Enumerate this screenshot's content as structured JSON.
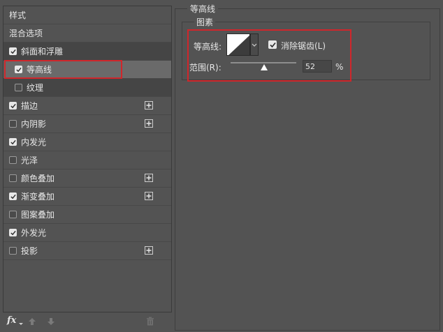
{
  "left": {
    "items": [
      {
        "label": "样式",
        "type": "header"
      },
      {
        "label": "混合选项",
        "type": "header"
      },
      {
        "label": "斜面和浮雕",
        "checked": true,
        "add": false,
        "state": "active"
      },
      {
        "label": "等高线",
        "checked": true,
        "add": false,
        "state": "selected",
        "indent": true
      },
      {
        "label": "纹理",
        "checked": false,
        "add": false,
        "state": "active",
        "indent": true
      },
      {
        "label": "描边",
        "checked": true,
        "add": true
      },
      {
        "label": "内阴影",
        "checked": false,
        "add": true
      },
      {
        "label": "内发光",
        "checked": true,
        "add": false
      },
      {
        "label": "光泽",
        "checked": false,
        "add": false
      },
      {
        "label": "颜色叠加",
        "checked": false,
        "add": true
      },
      {
        "label": "渐变叠加",
        "checked": true,
        "add": true
      },
      {
        "label": "图案叠加",
        "checked": false,
        "add": false
      },
      {
        "label": "外发光",
        "checked": true,
        "add": false
      },
      {
        "label": "投影",
        "checked": false,
        "add": true
      }
    ],
    "footer": {
      "fx_label": "fx"
    }
  },
  "right": {
    "section_title": "等高线",
    "group_title": "图素",
    "contour_label": "等高线:",
    "antialias_label": "消除锯齿(L)",
    "antialias_checked": true,
    "range_label": "范围(R):",
    "range_value": "52",
    "range_unit": "%"
  },
  "colors": {
    "highlight": "#d0262b",
    "panel": "#535353",
    "selected": "#6a6a6a"
  }
}
